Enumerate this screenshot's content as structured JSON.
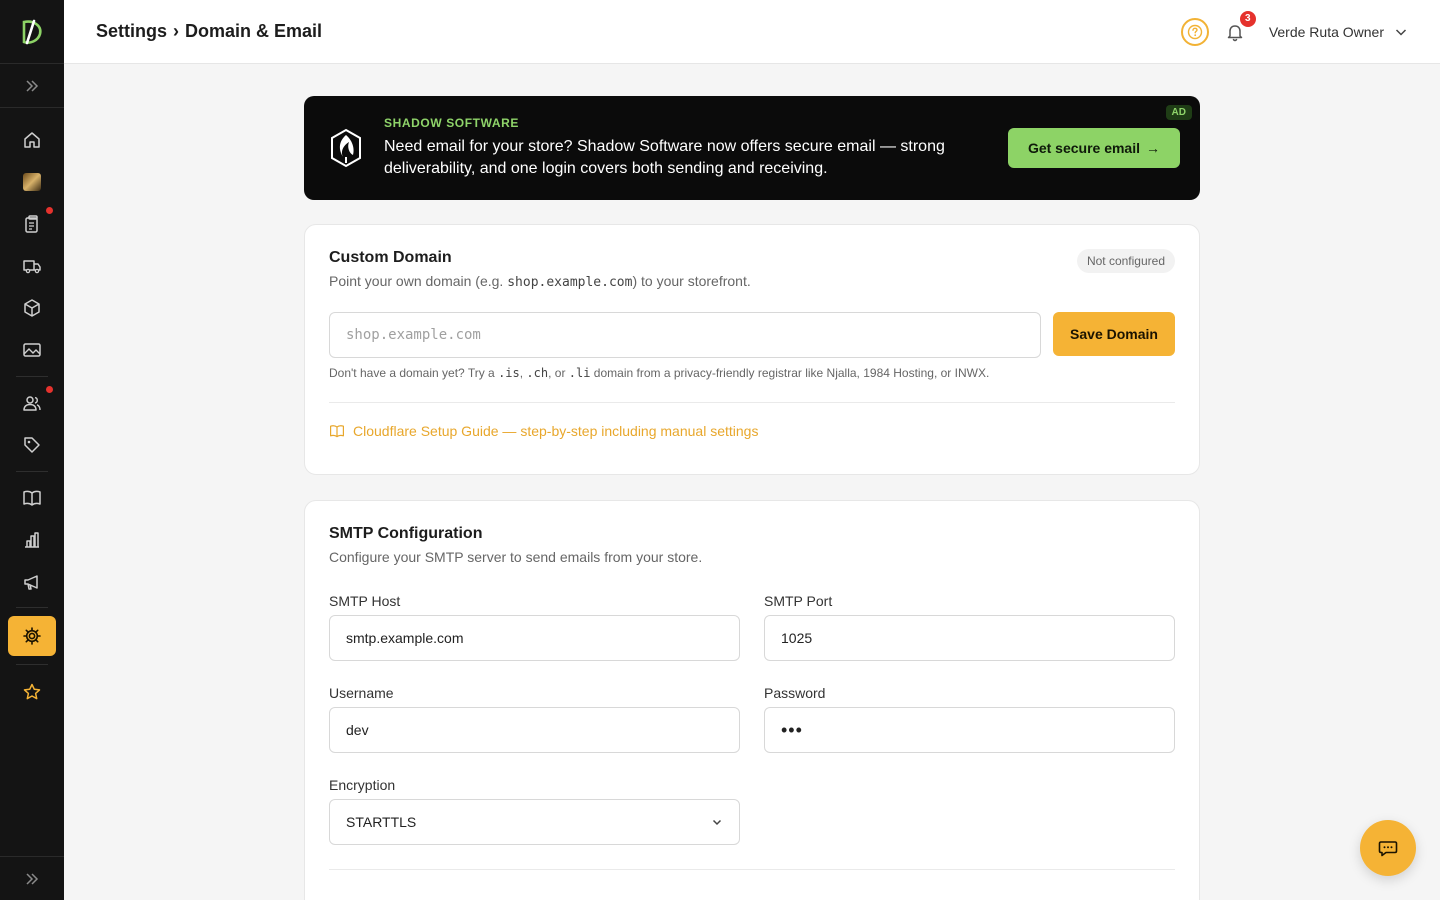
{
  "header": {
    "breadcrumb_root": "Settings",
    "breadcrumb_sep": "›",
    "breadcrumb_current": "Domain & Email",
    "notifications_count": "3",
    "user_name": "Verde Ruta Owner"
  },
  "ad": {
    "brand": "SHADOW SOFTWARE",
    "message": "Need email for your store? Shadow Software now offers secure email — strong deliverability, and one login covers both sending and receiving.",
    "cta": "Get secure email",
    "cta_arrow": "→",
    "tag": "AD"
  },
  "custom_domain": {
    "title": "Custom Domain",
    "status": "Not configured",
    "sub_before": "Point your own domain (e.g. ",
    "sub_code": "shop.example.com",
    "sub_after": ") to your storefront.",
    "input_placeholder": "shop.example.com",
    "save_label": "Save Domain",
    "hint_1": "Don't have a domain yet? Try a ",
    "hint_tld1": ".is",
    "hint_2": ", ",
    "hint_tld2": ".ch",
    "hint_3": ", or ",
    "hint_tld3": ".li",
    "hint_4": " domain from a privacy-friendly registrar like Njalla, 1984 Hosting, or INWX.",
    "guide_link": "Cloudflare Setup Guide — step-by-step including manual settings"
  },
  "smtp": {
    "title": "SMTP Configuration",
    "subtitle": "Configure your SMTP server to send emails from your store.",
    "host_label": "SMTP Host",
    "host_value": "smtp.example.com",
    "port_label": "SMTP Port",
    "port_value": "1025",
    "username_label": "Username",
    "username_value": "dev",
    "password_label": "Password",
    "password_value": "•••",
    "encryption_label": "Encryption",
    "encryption_value": "STARTTLS"
  },
  "colors": {
    "accent": "#f5b335",
    "sidebar_bg": "#141414",
    "ad_green": "#8dd366",
    "alert_red": "#e5322d"
  }
}
